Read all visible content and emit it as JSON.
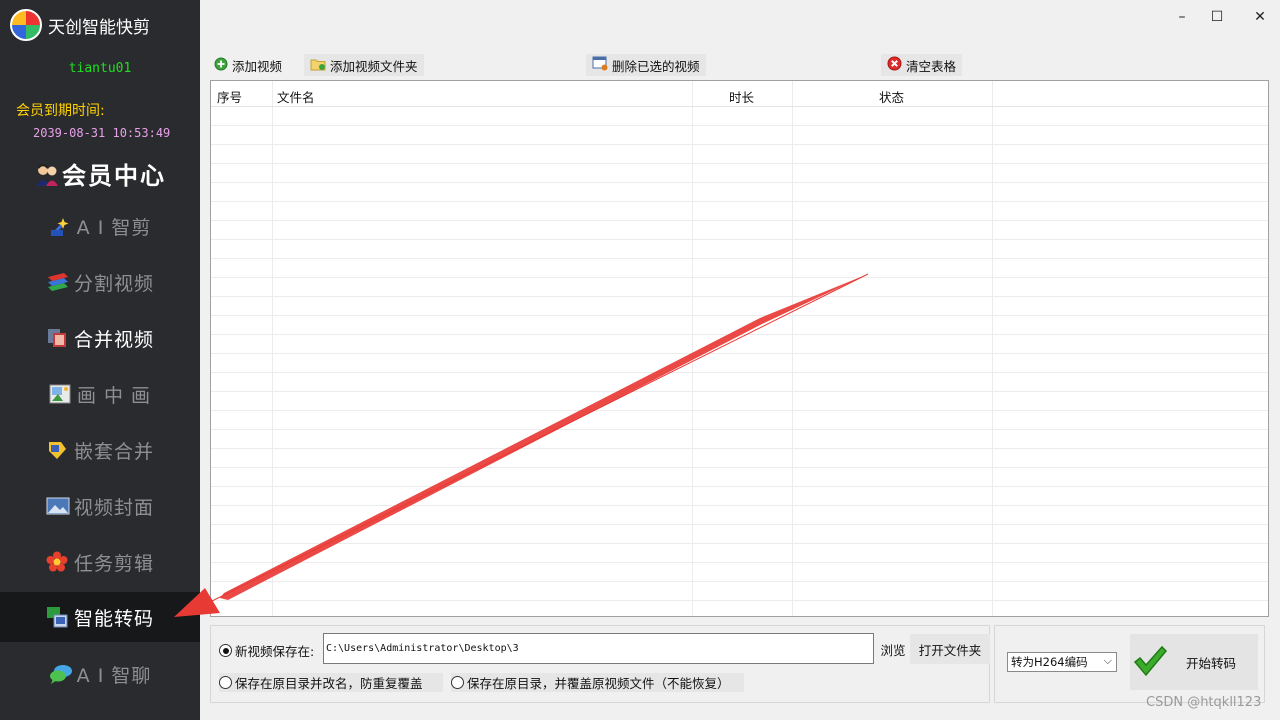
{
  "sidebar": {
    "app_name": "天创智能快剪",
    "username": "tiantu01",
    "expiry_label": "会员到期时间:",
    "expiry_value": "2039-08-31 10:53:49",
    "items": [
      {
        "label": "会员中心",
        "icon": "vip-users-icon"
      },
      {
        "label": "A I 智剪",
        "icon": "ai-magic-icon"
      },
      {
        "label": "分割视频",
        "icon": "split-layers-icon"
      },
      {
        "label": "合并视频",
        "icon": "merge-video-icon"
      },
      {
        "label": "画 中 画",
        "icon": "picture-in-picture-icon"
      },
      {
        "label": "嵌套合并",
        "icon": "nested-merge-icon"
      },
      {
        "label": "视频封面",
        "icon": "video-cover-icon"
      },
      {
        "label": "任务剪辑",
        "icon": "task-flower-icon"
      },
      {
        "label": "智能转码",
        "icon": "transcode-icon"
      },
      {
        "label": "A I 智聊",
        "icon": "chat-bubbles-icon"
      }
    ],
    "active_item": "智能转码"
  },
  "window_controls": {
    "minimize": "–",
    "maximize": "☐",
    "close": "✕"
  },
  "toolbar": {
    "add_video": "添加视频",
    "add_folder": "添加视频文件夹",
    "delete_selected": "删除已选的视频",
    "clear_table": "清空表格"
  },
  "table": {
    "columns": [
      "序号",
      "文件名",
      "时长",
      "状态"
    ],
    "rows": []
  },
  "output": {
    "new_save_label": "新视频保存在:",
    "path_value": "C:\\Users\\Administrator\\Desktop\\3",
    "browse": "浏览",
    "open_folder": "打开文件夹",
    "rename_option": "保存在原目录并改名，防重复覆盖",
    "overwrite_option": "保存在原目录，并覆盖原视频文件（不能恢复）",
    "selected_option": "new_save"
  },
  "encode": {
    "selected": "转为H264编码",
    "start_label": "开始转码"
  },
  "watermark": "CSDN @htqkll123",
  "colors": {
    "sidebar_bg": "#2a2b2e",
    "active_bg": "#17181a",
    "username": "#1ee01e",
    "expiry_label": "#ffd200",
    "expiry_value": "#e8a0e8",
    "arrow": "#e83a35",
    "checkmark": "#2f9a1f"
  }
}
